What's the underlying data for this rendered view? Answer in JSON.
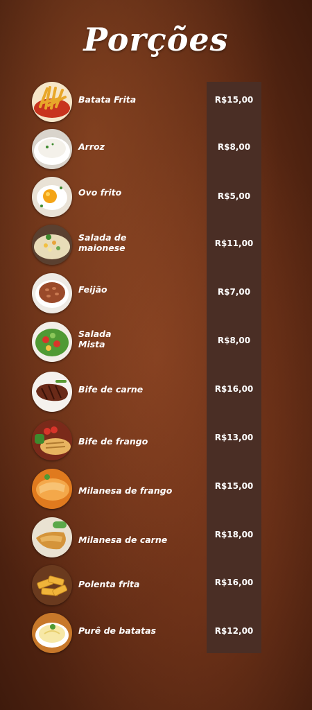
{
  "title": "Porções",
  "items": [
    {
      "name": "Batata Frita",
      "price": "R$15,00",
      "icon": "fries-icon"
    },
    {
      "name": "Arroz",
      "price": "R$8,00",
      "icon": "rice-icon"
    },
    {
      "name": "Ovo frito",
      "price": "R$5,00",
      "icon": "fried-egg-icon"
    },
    {
      "name_lines": [
        "Salada de",
        "maionese"
      ],
      "price": "R$11,00",
      "icon": "mayo-salad-icon"
    },
    {
      "name": "Feijão",
      "price": "R$7,00",
      "icon": "beans-icon"
    },
    {
      "name_lines": [
        "Salada",
        "Mista"
      ],
      "price": "R$8,00",
      "icon": "mixed-salad-icon"
    },
    {
      "name": "Bife de carne",
      "price": "R$16,00",
      "icon": "beef-steak-icon"
    },
    {
      "name": "Bife de frango",
      "price": "R$13,00",
      "icon": "chicken-steak-icon"
    },
    {
      "name": "Milanesa de frango",
      "price": "R$15,00",
      "icon": "chicken-milanesa-icon"
    },
    {
      "name": "Milanesa de carne",
      "price": "R$18,00",
      "icon": "beef-milanesa-icon"
    },
    {
      "name": "Polenta frita",
      "price": "R$16,00",
      "icon": "fried-polenta-icon"
    },
    {
      "name": "Purê de batatas",
      "price": "R$12,00",
      "icon": "mashed-potatoes-icon"
    }
  ]
}
